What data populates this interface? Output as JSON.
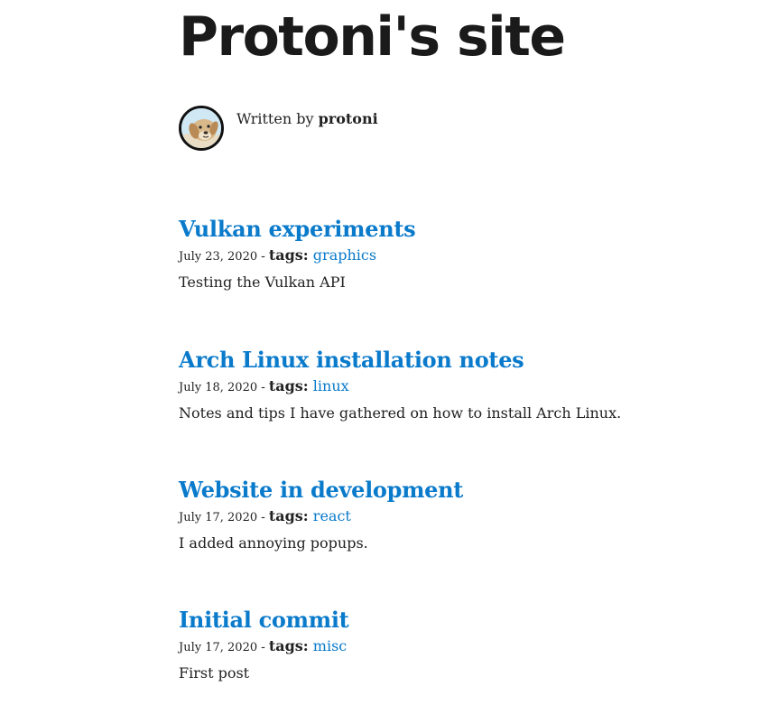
{
  "site": {
    "title": "Protoni's site"
  },
  "author": {
    "prefix": "Written by",
    "name": "protoni",
    "avatar_icon": "dog-avatar-icon"
  },
  "posts": [
    {
      "title": "Vulkan experiments",
      "date": "July 23, 2020",
      "separator": "-",
      "tags_label": "tags:",
      "tag": "graphics",
      "description": "Testing the Vulkan API"
    },
    {
      "title": "Arch Linux installation notes",
      "date": "July 18, 2020",
      "separator": "-",
      "tags_label": "tags:",
      "tag": "linux",
      "description": "Notes and tips I have gathered on how to install Arch Linux."
    },
    {
      "title": "Website in development",
      "date": "July 17, 2020",
      "separator": "-",
      "tags_label": "tags:",
      "tag": "react",
      "description": "I added annoying popups."
    },
    {
      "title": "Initial commit",
      "date": "July 17, 2020",
      "separator": "-",
      "tags_label": "tags:",
      "tag": "misc",
      "description": "First post"
    }
  ],
  "colors": {
    "link": "#0a7acb",
    "text": "#222222",
    "title": "#1a1a1a"
  }
}
